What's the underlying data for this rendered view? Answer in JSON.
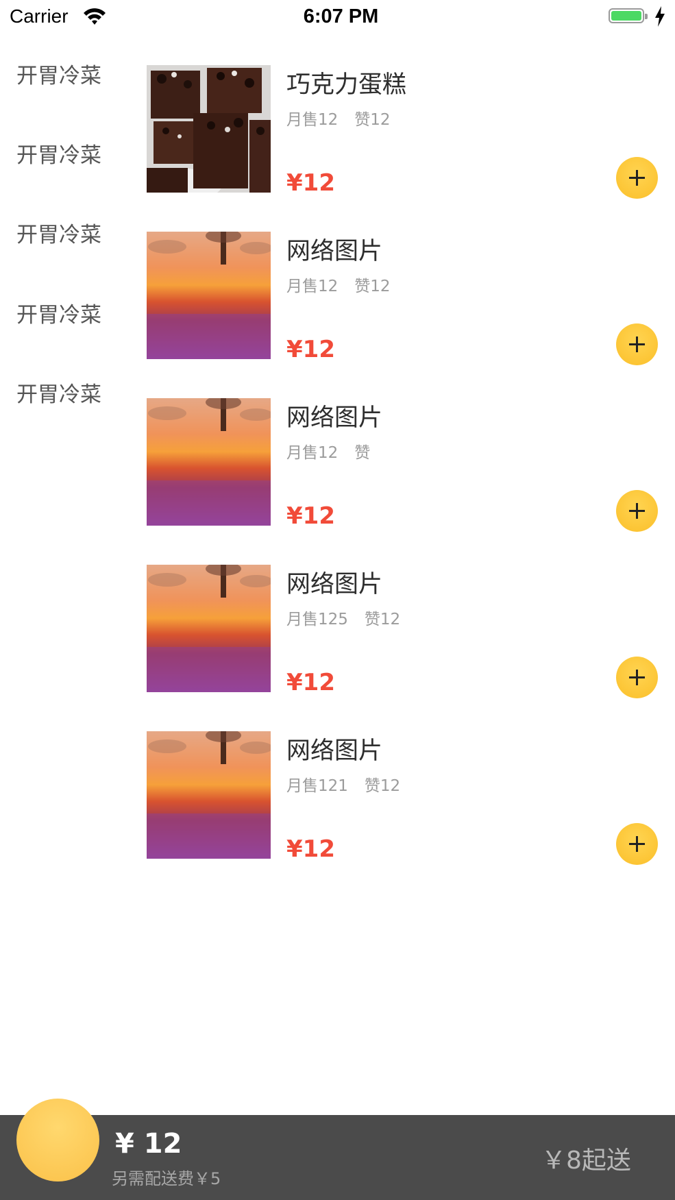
{
  "status_bar": {
    "carrier": "Carrier",
    "time": "6:07 PM",
    "battery_color": "#4cd964",
    "icons": [
      "wifi-icon",
      "battery-icon",
      "charging-bolt-icon"
    ]
  },
  "menu": {
    "items": [
      {
        "label": "开胃冷菜"
      },
      {
        "label": "开胃冷菜"
      },
      {
        "label": "开胃冷菜"
      },
      {
        "label": "开胃冷菜"
      },
      {
        "label": "开胃冷菜"
      }
    ]
  },
  "foods": [
    {
      "name": "巧克力蛋糕",
      "sold": "月售12",
      "likes": "赞12",
      "price": "¥12",
      "image": "chocolate-cake"
    },
    {
      "name": "网络图片",
      "sold": "月售12",
      "likes": "赞12",
      "price": "¥12",
      "image": "flower-field"
    },
    {
      "name": "网络图片",
      "sold": "月售12",
      "likes": "赞",
      "price": "¥12",
      "image": "flower-field"
    },
    {
      "name": "网络图片",
      "sold": "月售125",
      "likes": "赞12",
      "price": "¥12",
      "image": "flower-field"
    },
    {
      "name": "网络图片",
      "sold": "月售121",
      "likes": "赞12",
      "price": "¥12",
      "image": "flower-field"
    }
  ],
  "cart": {
    "total": "¥ 12",
    "delivery_fee": "另需配送费￥5",
    "min_order": "￥8起送",
    "accent_color": "#fbc149",
    "bar_color": "#4b4b4b"
  },
  "colors": {
    "price": "#f14b39",
    "add_button": "#fbbf2a"
  }
}
